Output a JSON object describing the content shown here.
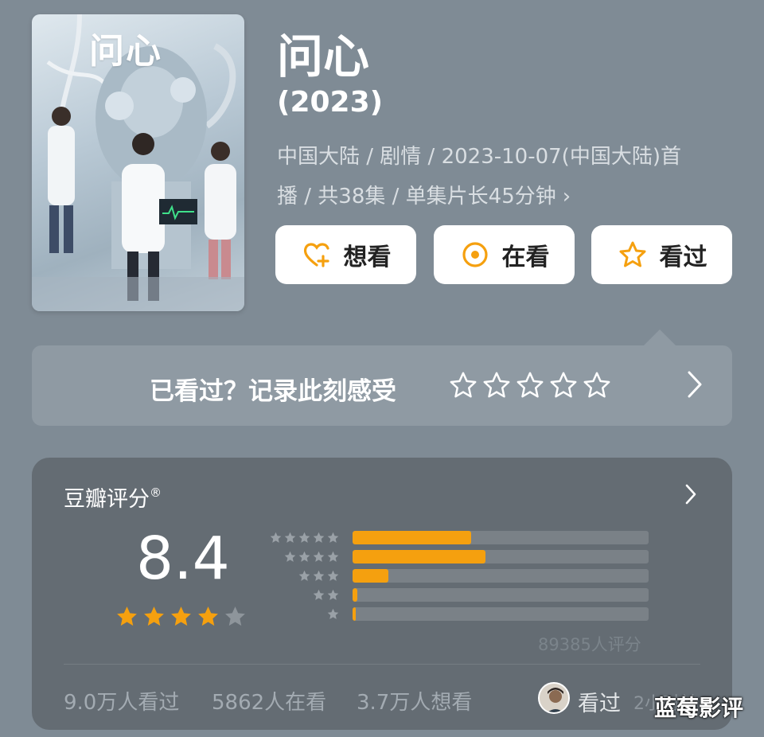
{
  "poster": {
    "title_text": "问心"
  },
  "header": {
    "title": "问心",
    "year": "(2023)",
    "meta_line1": "中国大陆 / 剧情 / 2023-10-07(中国大陆)首",
    "meta_line2": "播 / 共38集 / 单集片长45分钟"
  },
  "actions": {
    "want_label": "想看",
    "watching_label": "在看",
    "watched_label": "看过"
  },
  "rate_prompt": {
    "text": "已看过？记录此刻感受"
  },
  "rating": {
    "label": "豆瓣评分",
    "reg_mark": "®",
    "score": "8.4",
    "stars_value": 4,
    "stars_max": 5,
    "distribution": [
      {
        "stars": 5,
        "fraction": 0.4
      },
      {
        "stars": 4,
        "fraction": 0.45
      },
      {
        "stars": 3,
        "fraction": 0.12
      },
      {
        "stars": 2,
        "fraction": 0.015
      },
      {
        "stars": 1,
        "fraction": 0.008
      }
    ],
    "count": "89385人评分"
  },
  "stats": {
    "watched": "9.0万人看过",
    "watching": "5862人在看",
    "want": "3.7万人想看",
    "friend_status": "看过",
    "friend_time": "2小时前"
  },
  "watermark": {
    "text": "蓝莓影评"
  },
  "colors": {
    "accent": "#f5a00f",
    "background": "#7f8b95",
    "card": "#646c73"
  },
  "icons": {
    "want": "heart-plus-icon",
    "watching": "target-circle-icon",
    "watched": "star-outline-icon",
    "chevron": "chevron-right-icon"
  }
}
